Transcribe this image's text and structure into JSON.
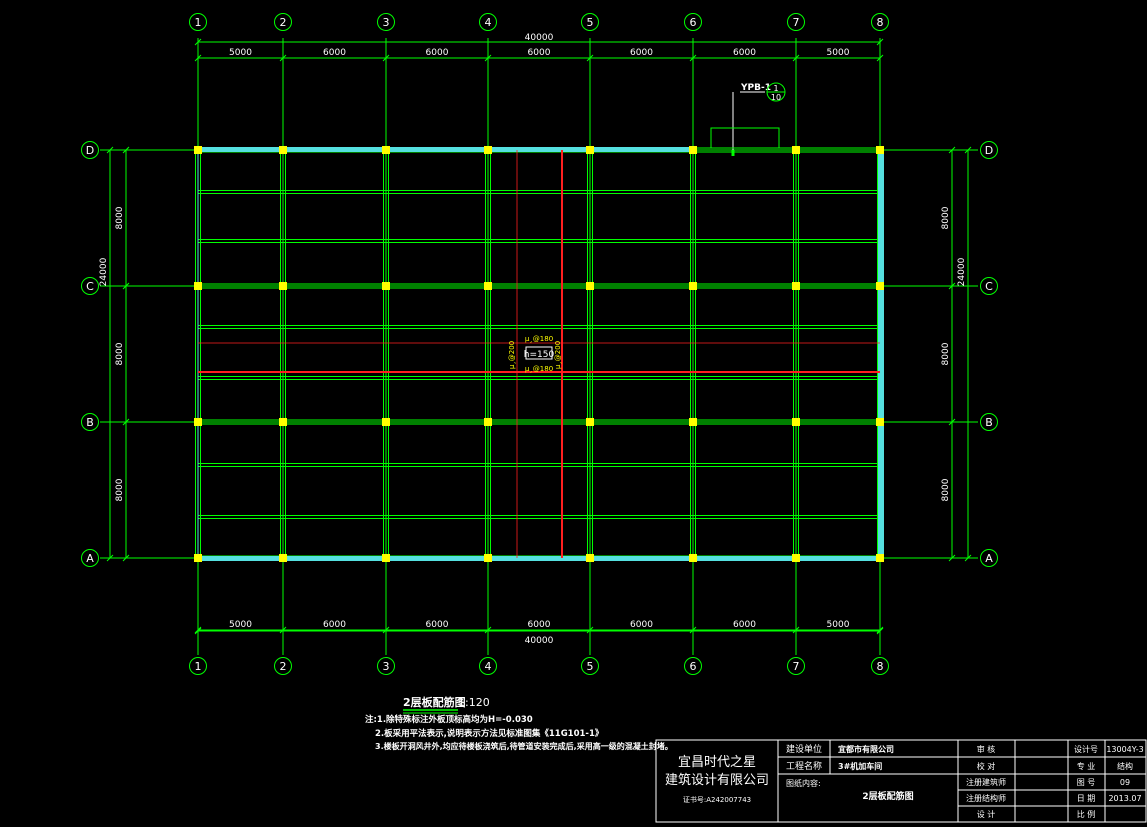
{
  "grid": {
    "columns": [
      "1",
      "2",
      "3",
      "4",
      "5",
      "6",
      "7",
      "8"
    ],
    "rows": [
      "D",
      "C",
      "B",
      "A"
    ]
  },
  "dimensions": {
    "col_spans": [
      "5000",
      "6000",
      "6000",
      "6000",
      "6000",
      "6000",
      "5000"
    ],
    "total_width": "40000",
    "row_spans": [
      "8000",
      "8000",
      "8000"
    ],
    "total_height": "24000"
  },
  "annotations": {
    "detail_tag": "YPB-1",
    "detail_circle_top": "1",
    "detail_circle_bottom": "10",
    "slab_tag": "h=150",
    "rebar_top": "µ¸@180",
    "rebar_bottom": "µ¸@180",
    "rebar_left": "µ¸@200",
    "rebar_right": "µ¸@200"
  },
  "drawing_title": {
    "title": "2层板配筋图",
    "scale": "1:120"
  },
  "notes": [
    "注:1.除特殊标注外板顶标高均为H=-0.030",
    "2.板采用平法表示,说明表示方法见标准图集《11G101-1》",
    "3.楼板开洞风井外,均应待楼板浇筑后,待管道安装完成后,采用高一级的混凝土封堵。"
  ],
  "title_block": {
    "company_line1": "宜昌时代之星",
    "company_line2": "建筑设计有限公司",
    "cert": "证书号:A242007743",
    "client_label": "建设单位",
    "client_value": "宜都市有限公司",
    "project_label": "工程名称",
    "project_value": "3#机加车间",
    "content_label": "图纸内容:",
    "content_value": "2层板配筋图",
    "roles": [
      "审          核",
      "校          对",
      "注册建筑师",
      "注册结构师",
      "设          计"
    ],
    "info_labels": [
      "设计号",
      "专    业",
      "图    号",
      "日    期",
      "比    例"
    ],
    "info_values": [
      "13004Y-3",
      "结构",
      "09",
      "2013.07",
      ""
    ]
  },
  "colors": {
    "background": "#000000",
    "axis_green": "#00ff00",
    "cyan_wall": "#55e0e0",
    "column_yellow": "#ffff00",
    "rebar_red": "#ff2020",
    "white": "#ffffff"
  }
}
